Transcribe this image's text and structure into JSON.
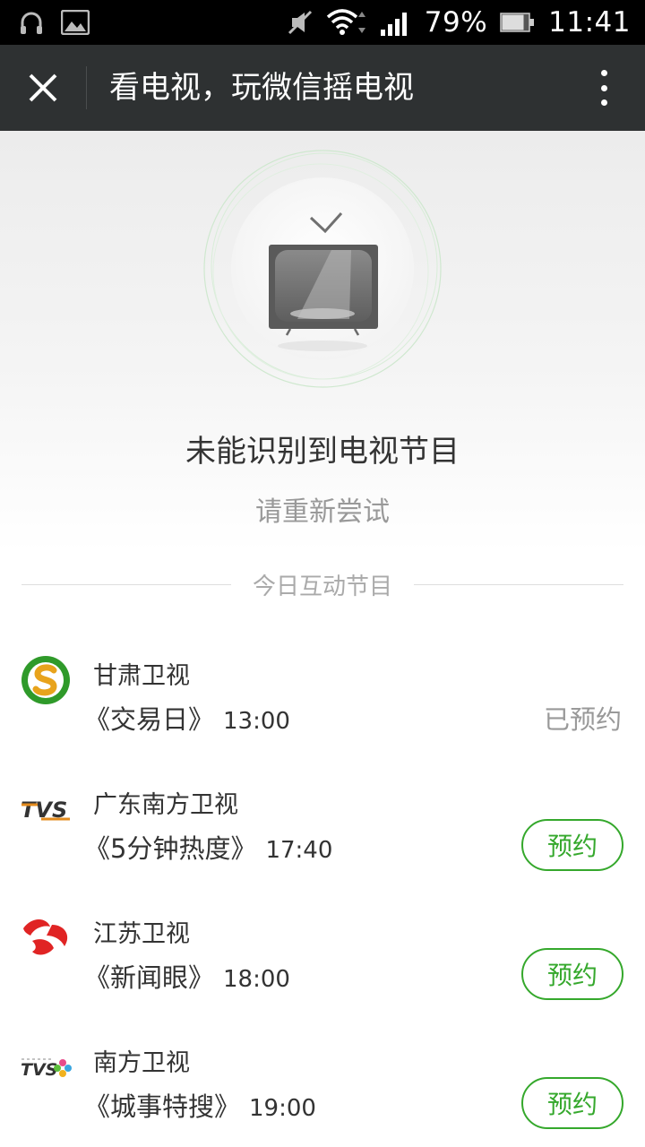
{
  "status_bar": {
    "battery": "79%",
    "time": "11:41"
  },
  "header": {
    "title": "看电视，玩微信摇电视"
  },
  "result": {
    "title": "未能识别到电视节目",
    "subtitle": "请重新尝试"
  },
  "section": {
    "label": "今日互动节目"
  },
  "programs": [
    {
      "channel": "甘肃卫视",
      "show": "《交易日》",
      "time": "13:00",
      "status": "已预约",
      "logo": "gansu-tv-logo"
    },
    {
      "channel": "广东南方卫视",
      "show": "《5分钟热度》",
      "time": "17:40",
      "button": "预约",
      "logo": "tvs-logo"
    },
    {
      "channel": "江苏卫视",
      "show": "《新闻眼》",
      "time": "18:00",
      "button": "预约",
      "logo": "jiangsu-tv-logo"
    },
    {
      "channel": "南方卫视",
      "show": "《城事特搜》",
      "time": "19:00",
      "button": "预约",
      "logo": "tvs-star-logo"
    }
  ],
  "colors": {
    "accent": "#35a82c",
    "titlebar": "#2e3132"
  }
}
